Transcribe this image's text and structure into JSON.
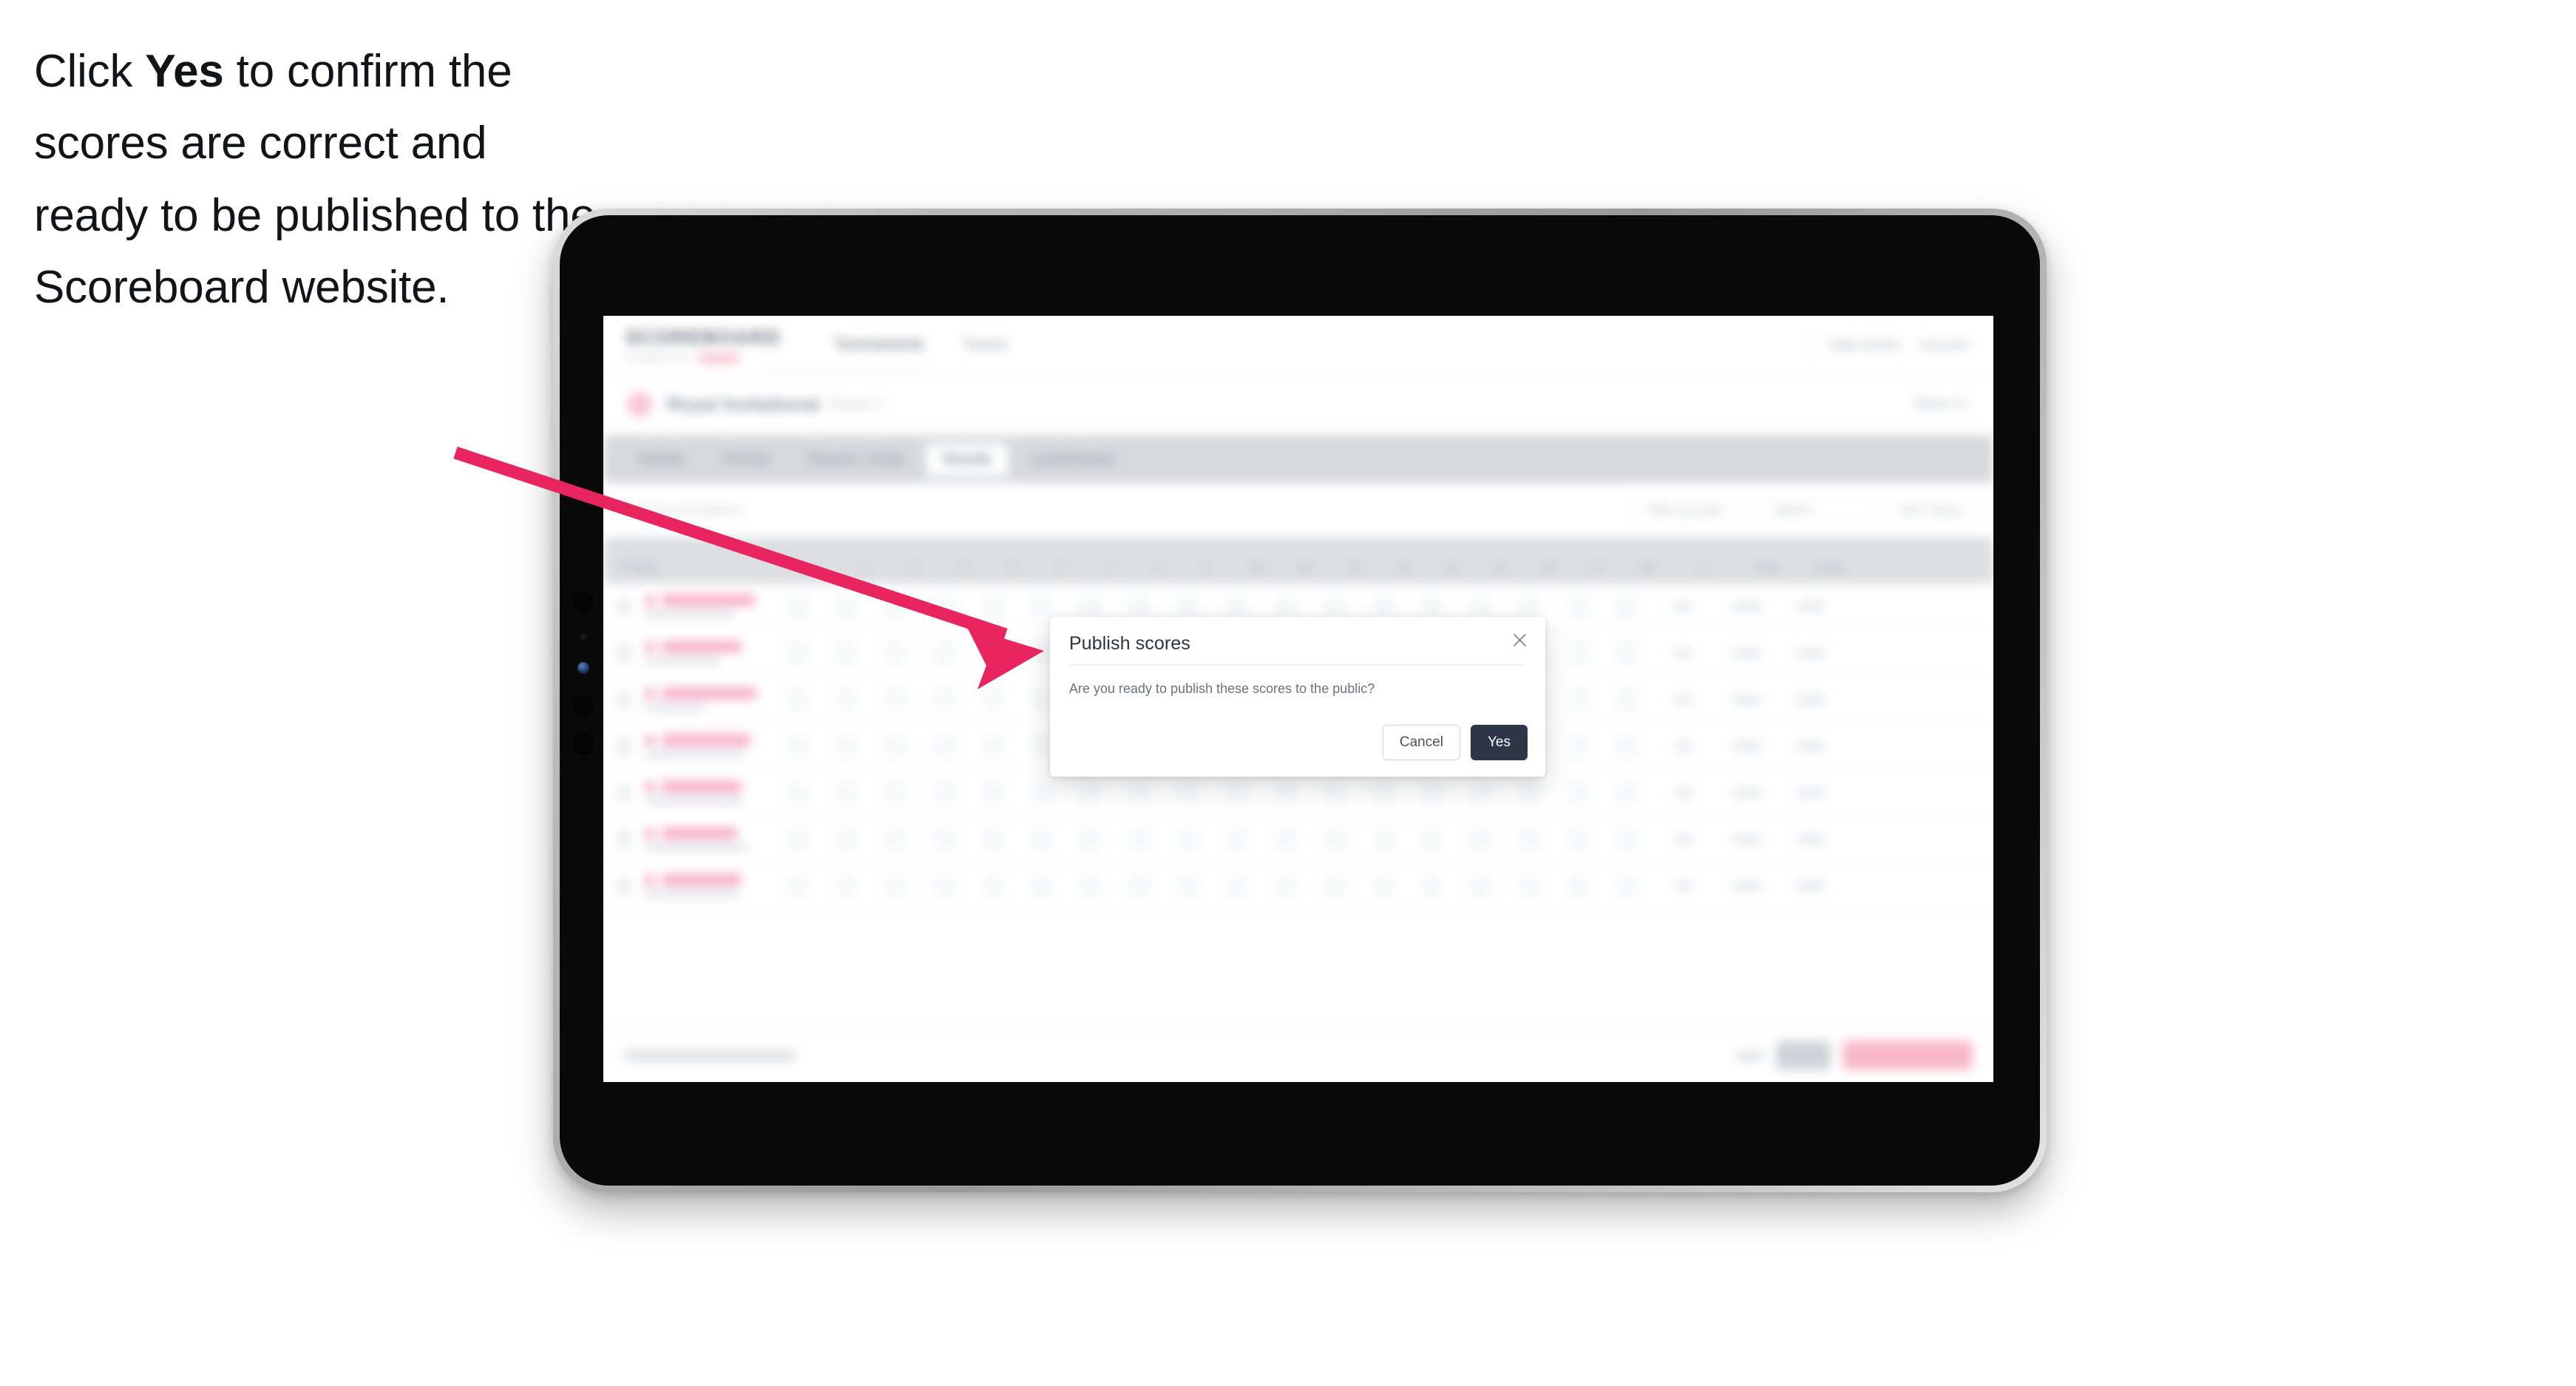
{
  "instruction": {
    "before": "Click ",
    "keyword": "Yes",
    "after": " to confirm the scores are correct and ready to be published to the Scoreboard website."
  },
  "annotation": {
    "arrow_color": "#e8255e",
    "arrow_name": "pointer-arrow"
  },
  "device": {
    "type": "tablet",
    "bezel_color": "#0a0a0a",
    "frame_color": "#b9b9b9"
  },
  "app": {
    "brand": {
      "wordmark": "SCOREBOARD",
      "tagline": "POWERED BY"
    },
    "topnav": [
      {
        "label": "Tournaments",
        "active": true
      },
      {
        "label": "Teams",
        "active": false
      }
    ],
    "topbar_right": [
      {
        "label": "Help Centre"
      },
      {
        "label": "Account"
      }
    ],
    "event": {
      "title": "Royal Invitational",
      "subtitle": "Round 2",
      "right_meta": "Week 12"
    },
    "tabs": [
      {
        "label": "Details",
        "active": false
      },
      {
        "label": "Format",
        "active": false
      },
      {
        "label": "Players / Draw",
        "active": false
      },
      {
        "label": "Results",
        "active": true
      },
      {
        "label": "Leaderboard",
        "active": false
      }
    ],
    "filterbar": {
      "left_label": "Showing all players",
      "controls": [
        {
          "label": "Filter by team"
        },
        {
          "label": "Search"
        },
        {
          "label": "Sort: Score"
        }
      ]
    },
    "table": {
      "columns": [
        "Player",
        "1",
        "2",
        "3",
        "4",
        "5",
        "6",
        "7",
        "8",
        "9",
        "10",
        "11",
        "12",
        "13",
        "14",
        "15",
        "16",
        "17",
        "18",
        "In",
        "Total",
        "Score"
      ],
      "rows": [
        {
          "name": "Marcus Tennant",
          "club": "Pinehurst Golf Club"
        },
        {
          "name": "Theo Pocock",
          "club": "Fairmont Links"
        },
        {
          "name": "Cameron Maddison",
          "club": "Birchwood"
        },
        {
          "name": "Kim Patterson",
          "club": "Crestview Country Club"
        },
        {
          "name": "Elena Rossi",
          "club": "Southbank Golf Academy"
        },
        {
          "name": "Dana Smith",
          "club": "Westerleigh Country Club"
        },
        {
          "name": "Will Walker",
          "club": "Northfield Golf Club"
        }
      ]
    },
    "footer": {
      "note": "No scores submitted yet",
      "buttons": [
        {
          "label": "Save",
          "style": "text"
        },
        {
          "label": "Edit",
          "style": "grey"
        },
        {
          "label": "Publish all scores",
          "style": "pink"
        }
      ]
    }
  },
  "modal": {
    "title": "Publish scores",
    "body": "Are you ready to publish these scores to the public?",
    "close_icon": "close-icon",
    "cancel_label": "Cancel",
    "yes_label": "Yes",
    "yes_color": "#2c3647",
    "cancel_border_color": "#c8d6ea"
  }
}
